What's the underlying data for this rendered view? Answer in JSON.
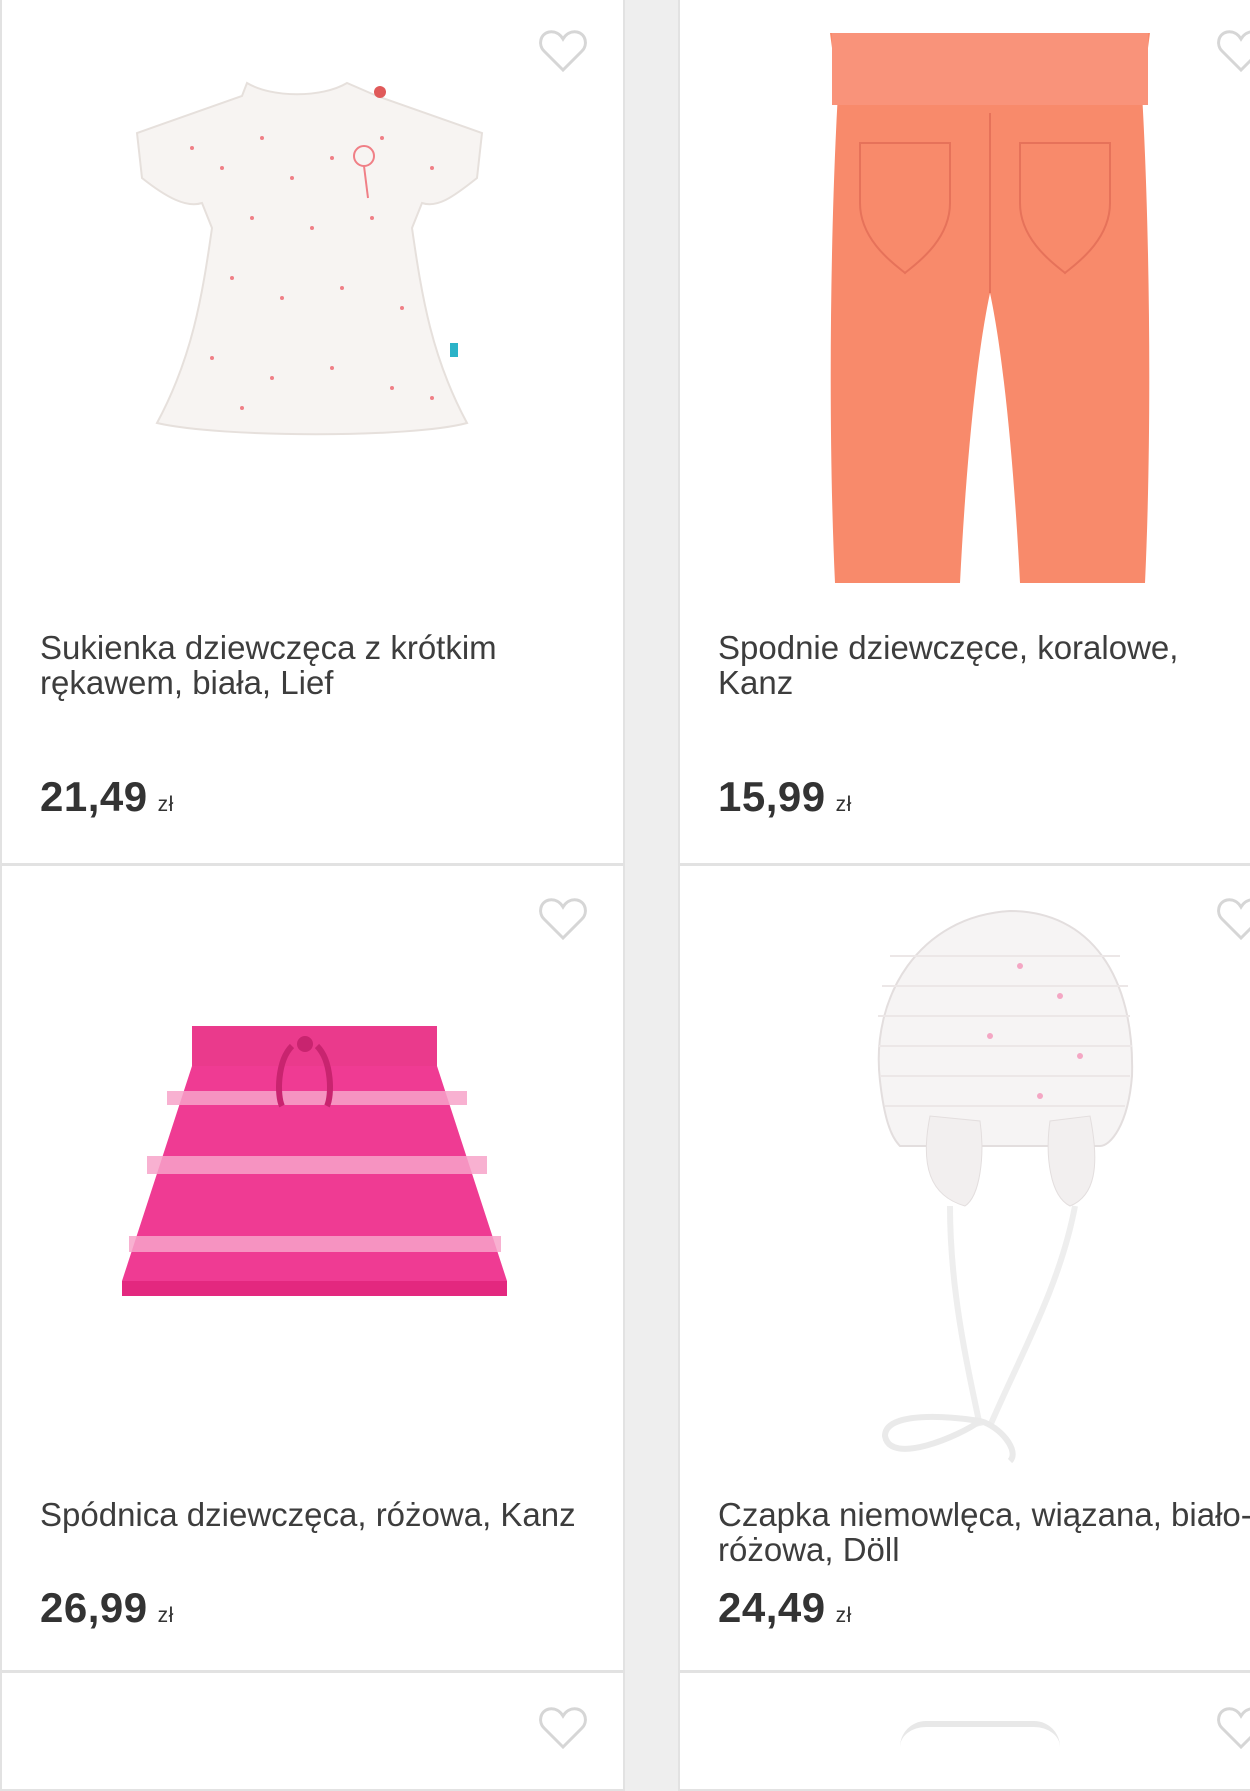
{
  "products": [
    {
      "title": "Sukienka dziewczęca z krótkim rękawem, biała, Lief",
      "price": "21,49",
      "currency": "zł",
      "image_icon": "dress-image"
    },
    {
      "title": "Spodnie dziewczęce, koralowe, Kanz",
      "price": "15,99",
      "currency": "zł",
      "image_icon": "pants-image"
    },
    {
      "title": "Spódnica dziewczęca, różowa, Kanz",
      "price": "26,99",
      "currency": "zł",
      "image_icon": "skirt-image"
    },
    {
      "title": "Czapka niemowlęca, wiązana, biało-różowa, Döll",
      "price": "24,49",
      "currency": "zł",
      "image_icon": "hat-image"
    }
  ],
  "colors": {
    "coral": "#f88a6b",
    "pink": "#ef3b93",
    "heart": "#d6d6d6",
    "text": "#3d3d3d"
  }
}
